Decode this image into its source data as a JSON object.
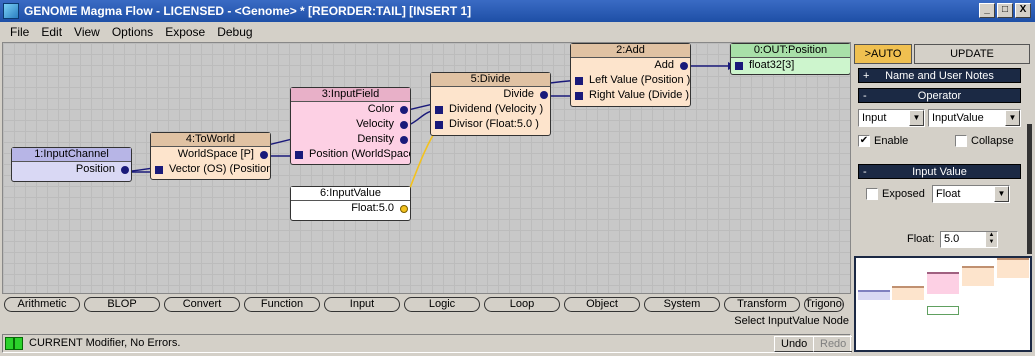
{
  "window": {
    "title": "GENOME Magma Flow - LICENSED - <Genome> *  [REORDER:TAIL] [INSERT 1]",
    "buttons": [
      "_",
      "□",
      "X"
    ]
  },
  "menu": [
    "File",
    "Edit",
    "View",
    "Options",
    "Expose",
    "Debug"
  ],
  "nodes": {
    "input_channel": {
      "title": "1:InputChannel",
      "out": "Position"
    },
    "to_world": {
      "title": "4:ToWorld",
      "out": "WorldSpace [P]",
      "in": "Vector (OS) (Position"
    },
    "input_field": {
      "title": "3:InputField",
      "outs": [
        "Color",
        "Velocity",
        "Density"
      ],
      "in": "Position (WorldSpace"
    },
    "divide": {
      "title": "5:Divide",
      "out": "Divide",
      "ins": [
        "Dividend (Velocity )",
        "Divisor (Float:5.0 )"
      ]
    },
    "add": {
      "title": "2:Add",
      "out": "Add",
      "ins": [
        "Left Value (Position )",
        "Right Value (Divide )"
      ]
    },
    "out_position": {
      "title": "0:OUT:Position",
      "in": "float32[3]"
    },
    "input_value": {
      "title": "6:InputValue",
      "out": "Float:5.0"
    }
  },
  "categories": [
    "Arithmetic",
    "BLOP",
    "Convert",
    "Function",
    "Input",
    "Logic",
    "Loop",
    "Object",
    "System",
    "Transform",
    "Trigonometry"
  ],
  "hint": "Select InputValue Node",
  "status": {
    "text": "CURRENT Modifier, No Errors.",
    "undo": "Undo",
    "redo": "Redo"
  },
  "panel": {
    "auto_button": ">AUTO",
    "update_button": "UPDATE",
    "rollout_name": {
      "sign": "+",
      "label": "Name and User Notes"
    },
    "rollout_operator": {
      "sign": "-",
      "label": "Operator"
    },
    "operator_type": "Input",
    "operator_value": "InputValue",
    "enable_label": "Enable",
    "enable_checked": true,
    "collapse_label": "Collapse",
    "collapse_checked": false,
    "rollout_input": {
      "sign": "-",
      "label": "Input Value"
    },
    "exposed_label": "Exposed",
    "exposed_checked": false,
    "value_type": "Float",
    "float_label": "Float:",
    "float_value": "5.0"
  },
  "colors": {
    "wire": "#1a1a7a",
    "wire_float": "#f3c21d",
    "node_input_channel": "#d9d8f4",
    "node_to_world": "#fde4cc",
    "node_input_field": "#fdd0e4",
    "node_divide": "#fde4cc",
    "node_add": "#fde4cc",
    "node_out": "#cdf5cd",
    "auto_button": "#f0c050"
  }
}
